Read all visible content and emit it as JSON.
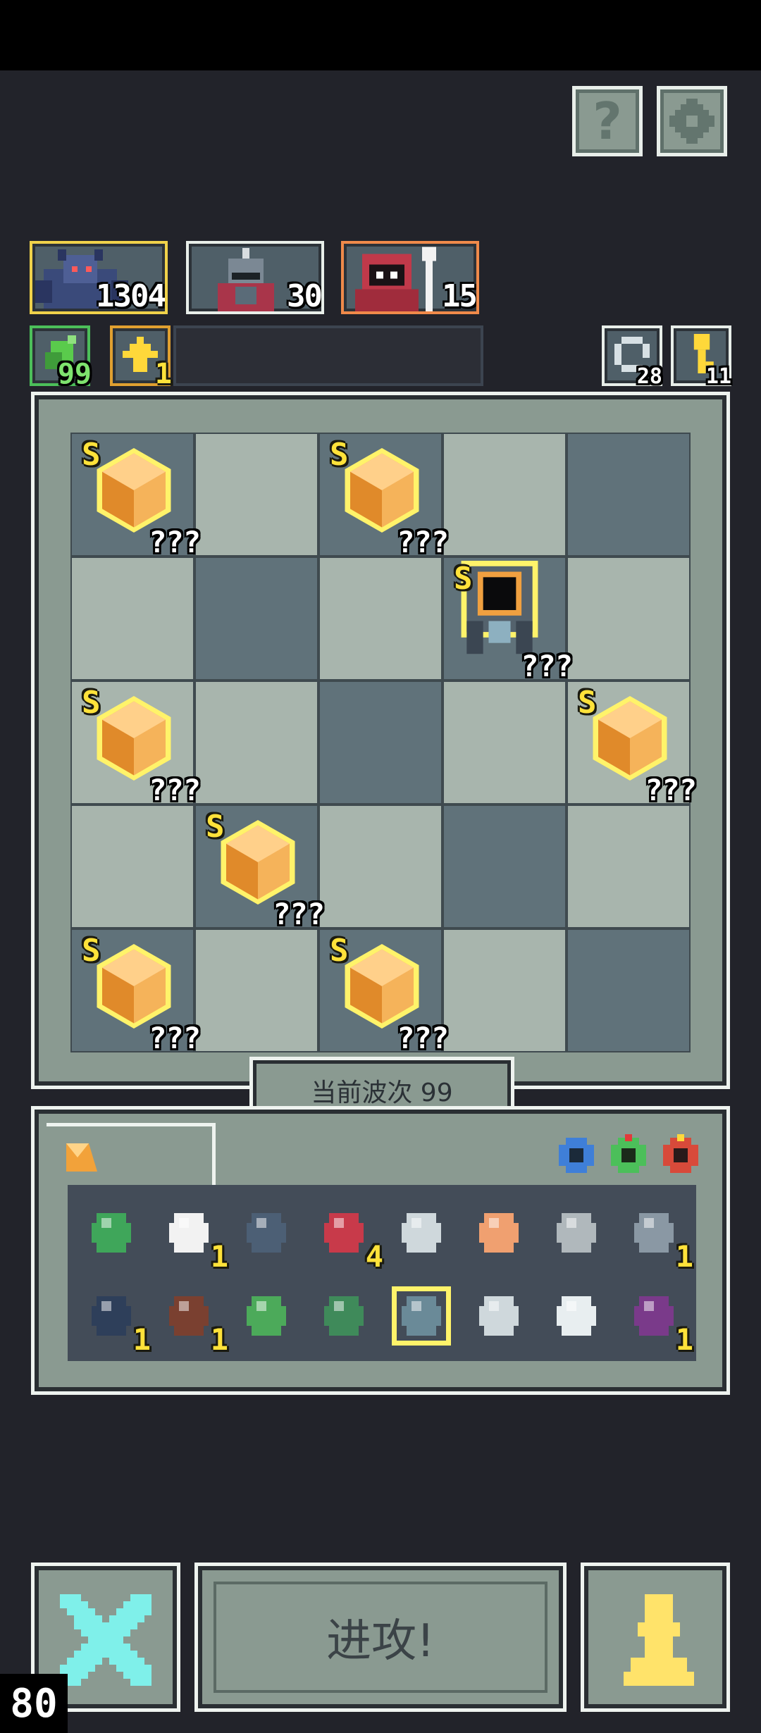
{
  "help_button": {
    "icon": "question-icon",
    "glyph": "?"
  },
  "settings_button": {
    "icon": "gear-icon"
  },
  "heroes": [
    {
      "name": "gargoyle-hero",
      "count": "1304",
      "border": "#f0d24a"
    },
    {
      "name": "knight-hero",
      "count": "30",
      "border": "#e8eee9"
    },
    {
      "name": "mage-hero",
      "count": "15",
      "border": "#f08a4a"
    }
  ],
  "resources": [
    {
      "name": "green-essence",
      "count": "99"
    },
    {
      "name": "upgrade-token",
      "count": "1"
    }
  ],
  "right_counters": [
    {
      "name": "reroll-icon",
      "count": "28"
    },
    {
      "name": "key-icon",
      "count": "11"
    }
  ],
  "board": {
    "rows": 5,
    "cols": 5,
    "pattern": [
      "dark",
      "light",
      "dark",
      "light",
      "dark",
      "light",
      "dark",
      "light",
      "dark",
      "light",
      "light",
      "light",
      "dark",
      "light",
      "light",
      "light",
      "dark",
      "light",
      "dark",
      "light",
      "dark",
      "light",
      "dark",
      "light",
      "dark"
    ],
    "units": [
      {
        "row": 0,
        "col": 0,
        "type": "crystal",
        "rank": "S",
        "label": "???"
      },
      {
        "row": 0,
        "col": 2,
        "type": "crystal",
        "rank": "S",
        "label": "???"
      },
      {
        "row": 1,
        "col": 3,
        "type": "void-golem",
        "rank": "S",
        "label": "???"
      },
      {
        "row": 2,
        "col": 0,
        "type": "crystal",
        "rank": "S",
        "label": "???"
      },
      {
        "row": 2,
        "col": 4,
        "type": "crystal",
        "rank": "S",
        "label": "???"
      },
      {
        "row": 3,
        "col": 1,
        "type": "crystal",
        "rank": "S",
        "label": "???"
      },
      {
        "row": 4,
        "col": 0,
        "type": "crystal",
        "rank": "S",
        "label": "???"
      },
      {
        "row": 4,
        "col": 2,
        "type": "crystal",
        "rank": "S",
        "label": "???"
      }
    ]
  },
  "wave": {
    "label": "当前波次 99"
  },
  "inventory_tabs": {
    "active": "crystal-shard-icon",
    "gems": [
      "blue-ring-icon",
      "green-ring-icon",
      "red-ring-icon"
    ]
  },
  "inventory": [
    {
      "icon": "green-flame-icon",
      "count": ""
    },
    {
      "icon": "bone-icon",
      "count": "1"
    },
    {
      "icon": "shield-icon",
      "count": ""
    },
    {
      "icon": "demon-mask-icon",
      "count": "4"
    },
    {
      "icon": "dagger-icon",
      "count": ""
    },
    {
      "icon": "hook-icon",
      "count": ""
    },
    {
      "icon": "slingshot-icon",
      "count": ""
    },
    {
      "icon": "knight-helm-icon",
      "count": "1"
    },
    {
      "icon": "dark-orb-icon",
      "count": "1"
    },
    {
      "icon": "totem-icon",
      "count": "1"
    },
    {
      "icon": "arrow-icon",
      "count": ""
    },
    {
      "icon": "serpent-ring-icon",
      "count": ""
    },
    {
      "icon": "crown-spikes-icon",
      "count": ""
    },
    {
      "icon": "sword-icon",
      "count": ""
    },
    {
      "icon": "moon-orb-icon",
      "count": ""
    },
    {
      "icon": "beast-orb-icon",
      "count": "1"
    }
  ],
  "buttons": {
    "cancel": "cancel-x-icon",
    "attack": "进攻!",
    "pawn": "pawn-icon"
  },
  "fps": "80"
}
